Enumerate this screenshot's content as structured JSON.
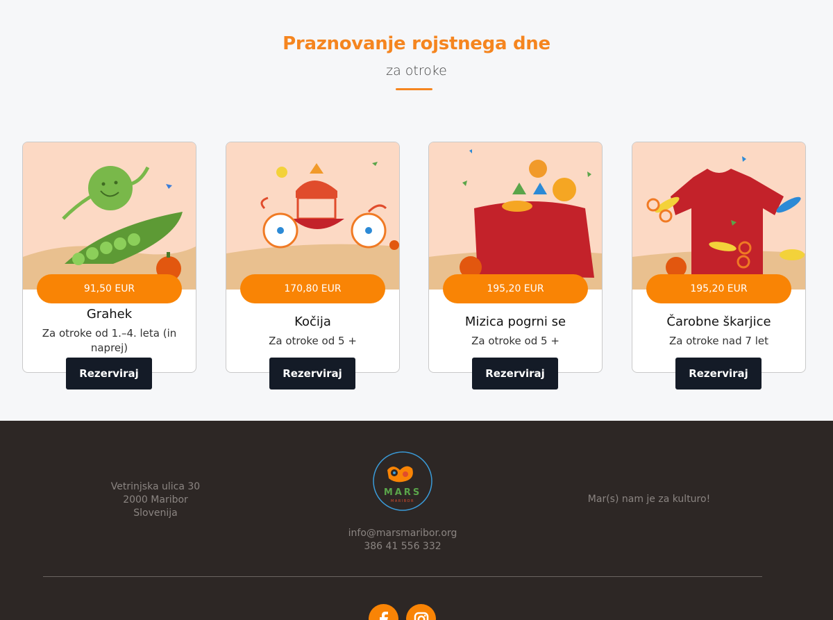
{
  "header": {
    "title": "Praznovanje rojstnega dne",
    "subtitle": "za otroke"
  },
  "cards": [
    {
      "price": "91,50 EUR",
      "name": "Grahek",
      "age": "Za otroke od 1.–4. leta (in naprej)",
      "button": "Rezerviraj",
      "illustration": "pea-icon"
    },
    {
      "price": "170,80 EUR",
      "name": "Kočija",
      "age": "Za otroke od 5 +",
      "button": "Rezerviraj",
      "illustration": "carriage-icon"
    },
    {
      "price": "195,20 EUR",
      "name": "Mizica pogrni se",
      "age": "Za otroke od 5 +",
      "button": "Rezerviraj",
      "illustration": "table-icon"
    },
    {
      "price": "195,20 EUR",
      "name": "Čarobne škarjice",
      "age": "Za otroke nad 7 let",
      "button": "Rezerviraj",
      "illustration": "scissors-shirt-icon"
    }
  ],
  "footer": {
    "address_line1": "Vetrinjska ulica 30",
    "address_line2": "2000 Maribor",
    "address_line3": "Slovenija",
    "logo_text": "MARS",
    "logo_subtext": "MARIBOR",
    "email": "info@marsmaribor.org",
    "phone": "386 41 556 332",
    "slogan": "Mar(s) nam je za kulturo!",
    "social": [
      "facebook-icon",
      "instagram-icon"
    ]
  },
  "colors": {
    "accent": "#f5851f",
    "price_pill": "#f98405",
    "button_dark": "#141b27",
    "footer_bg": "#2d2725",
    "card_illustration_bg": "#fcd9c4"
  }
}
